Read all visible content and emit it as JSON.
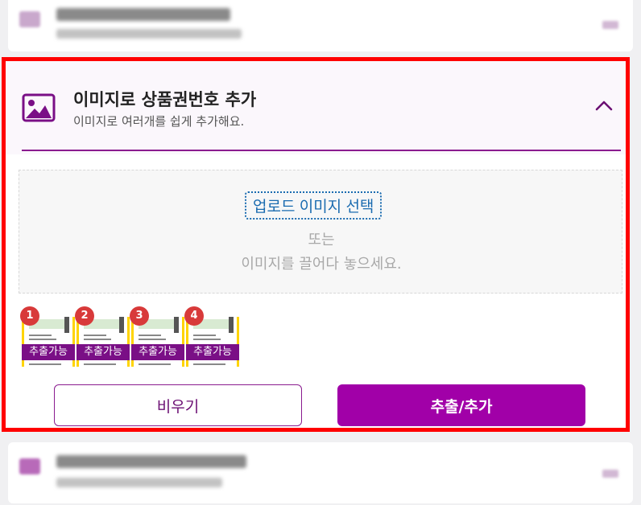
{
  "panel": {
    "title": "이미지로 상품권번호 추가",
    "subtitle": "이미지로 여러개를 쉽게 추가해요.",
    "icon": "image-icon",
    "collapse_icon": "chevron-up-icon"
  },
  "dropzone": {
    "upload_label": "업로드 이미지 선택",
    "or_text": "또는",
    "drag_text": "이미지를 끌어다 놓으세요."
  },
  "thumbnails": [
    {
      "number": "1",
      "status": "추출가능"
    },
    {
      "number": "2",
      "status": "추출가능"
    },
    {
      "number": "3",
      "status": "추출가능"
    },
    {
      "number": "4",
      "status": "추출가능"
    }
  ],
  "actions": {
    "clear_label": "비우기",
    "extract_label": "추출/추가"
  },
  "colors": {
    "accent": "#a100a8",
    "highlight_border": "#ff0000",
    "status_badge": "#7a0f86",
    "number_badge": "#d83a3a"
  }
}
